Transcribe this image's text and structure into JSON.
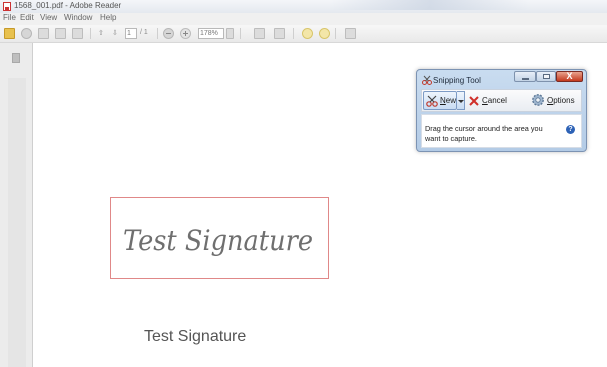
{
  "window": {
    "title": "1568_001.pdf - Adobe Reader"
  },
  "menu": {
    "items": [
      "File",
      "Edit",
      "View",
      "Window",
      "Help"
    ]
  },
  "toolbar": {
    "page_current": "1",
    "page_total": "/ 1",
    "zoom": "178%"
  },
  "document": {
    "handwritten_signature": "Test Signature",
    "typed_name": "Test Signature"
  },
  "snipping_tool": {
    "title": "Snipping Tool",
    "new_label": "New",
    "cancel_label": "Cancel",
    "options_label": "Options",
    "message": "Drag the cursor around the area you want to capture.",
    "close_glyph": "X",
    "help_glyph": "?"
  },
  "colors": {
    "signature_box_border": "#e08888",
    "snip_frame": "#b3cbe6",
    "close_button": "#c4391e"
  }
}
